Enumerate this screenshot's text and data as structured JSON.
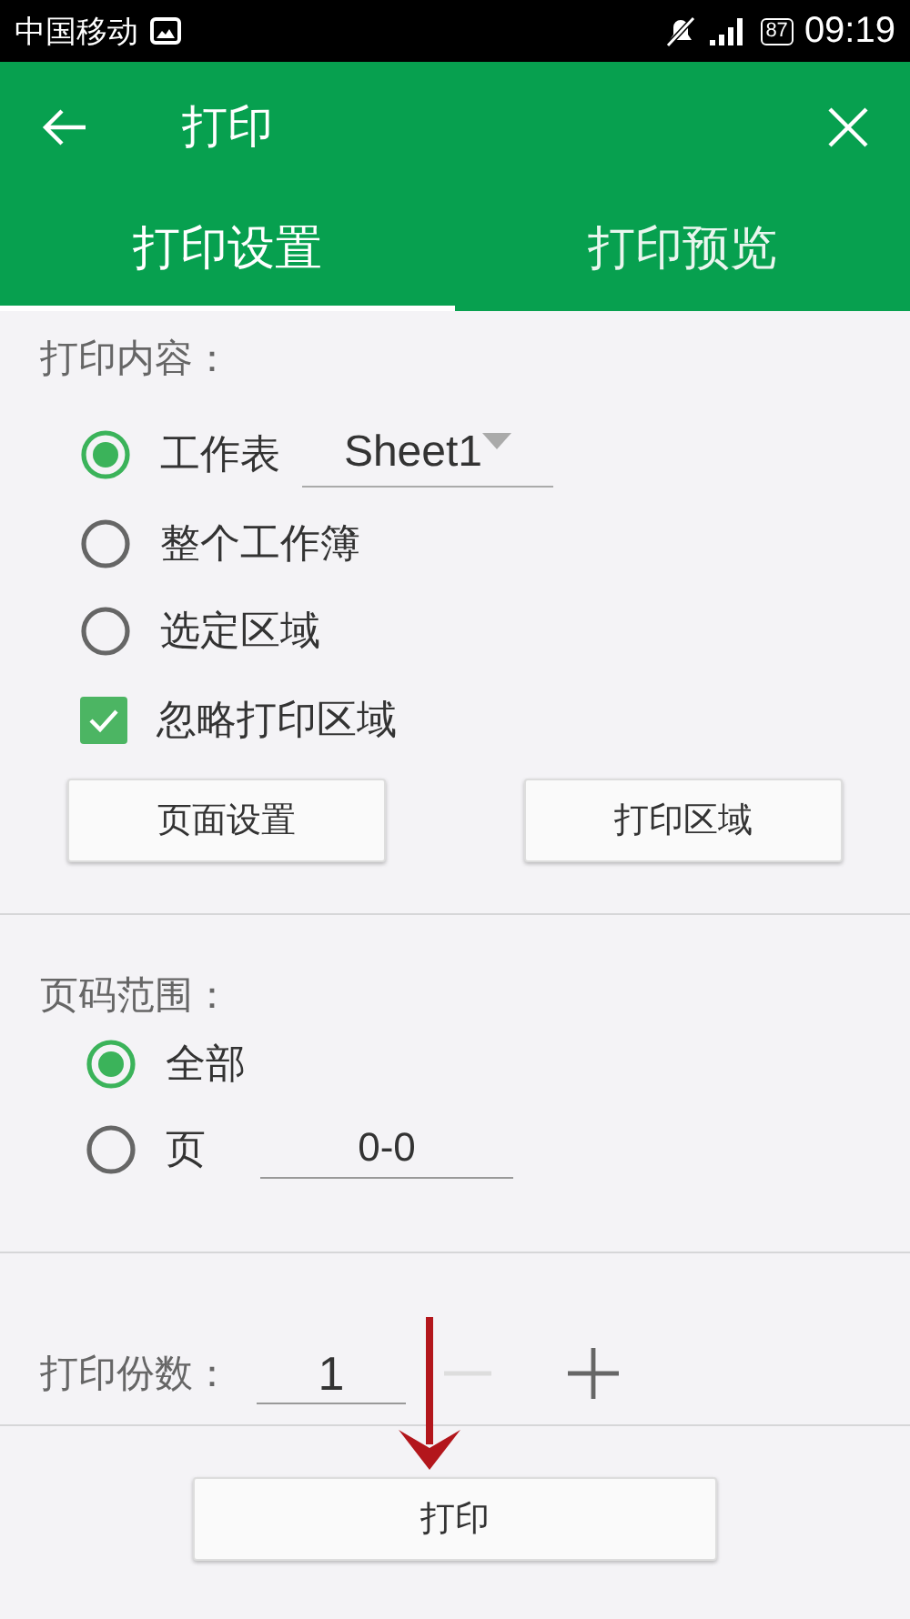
{
  "status_bar": {
    "carrier": "中国移动",
    "battery": "87",
    "time": "09:19"
  },
  "app_bar": {
    "title": "打印"
  },
  "tabs": [
    {
      "label": "打印设置",
      "selected": true
    },
    {
      "label": "打印预览",
      "selected": false
    }
  ],
  "content_section": {
    "heading": "打印内容：",
    "options": [
      {
        "kind": "radio",
        "label": "工作表",
        "selected": true,
        "dropdown": "Sheet1"
      },
      {
        "kind": "radio",
        "label": "整个工作簿",
        "selected": false
      },
      {
        "kind": "radio",
        "label": "选定区域",
        "selected": false
      },
      {
        "kind": "checkbox",
        "label": "忽略打印区域",
        "checked": true
      }
    ],
    "buttons": [
      "页面设置",
      "打印区域"
    ]
  },
  "page_range": {
    "heading": "页码范围：",
    "options": [
      {
        "label": "全部",
        "selected": true
      },
      {
        "label": "页",
        "selected": false,
        "field": "0-0"
      }
    ]
  },
  "copies": {
    "label": "打印份数：",
    "value": "1",
    "decrement_disabled": true
  },
  "print_button": "打印"
}
